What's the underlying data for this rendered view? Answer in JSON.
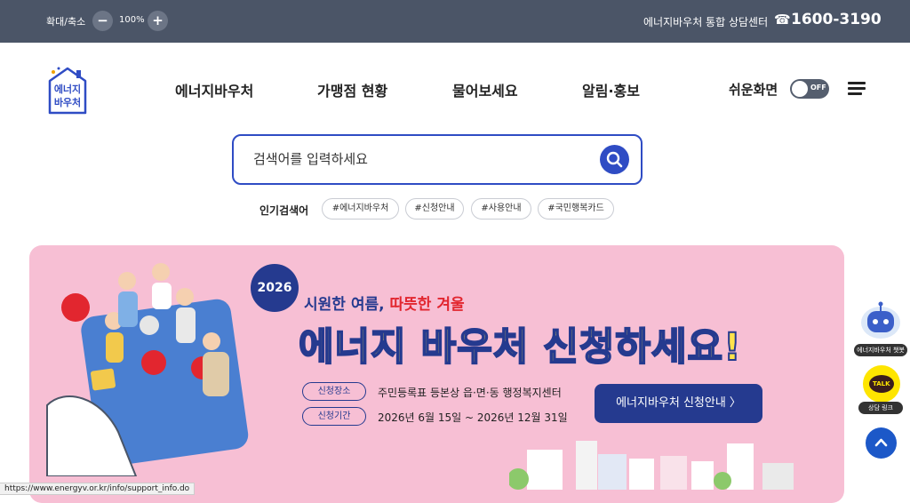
{
  "topbar": {
    "zoom_label": "확대/축소",
    "zoom_out_label": "−",
    "zoom_value": "100%",
    "zoom_in_label": "+",
    "hotline_label": "에너지바우처 통합 상담센터",
    "phone_icon": "☎",
    "hotline_number": "1600-3190"
  },
  "header": {
    "logo_text": [
      "에너지",
      "바우처"
    ],
    "nav": [
      "에너지바우처",
      "가맹점 현황",
      "물어보세요",
      "알림·홍보"
    ],
    "easy_mode_label": "쉬운화면",
    "easy_mode_state": "OFF"
  },
  "search": {
    "placeholder": "검색어를 입력하세요",
    "popular_label": "인기검색어",
    "tags": [
      "#에너지바우처",
      "#신청안내",
      "#사용안내",
      "#국민행복카드"
    ]
  },
  "banner": {
    "year": "2026",
    "subtitle_a": "시원한 여름, ",
    "subtitle_b": "따뜻한 겨울",
    "headline": "에너지 바우처 신청하세요!",
    "info": [
      {
        "label": "신청장소",
        "text": "주민등록표 등본상 읍·면·동 행정복지센터"
      },
      {
        "label": "신청기간",
        "text": "2026년 6월 15일 ~ 2026년 12월 31일"
      }
    ],
    "cta_label": "에너지바우처 신청안내 〉"
  },
  "side": {
    "chatbot_label": "에너지바우처 챗봇",
    "kakao_badge": "TALK",
    "kakao_label": "상담 링크"
  },
  "status_url": "https://www.energyv.or.kr/info/support_info.do",
  "colors": {
    "topbar": "#4b5567",
    "brand_blue": "#2f4cc4",
    "navy": "#253a8f",
    "banner_pink": "#f7bfd4",
    "headline_yellow": "#ffe34b",
    "kakao_yellow": "#fee500"
  }
}
